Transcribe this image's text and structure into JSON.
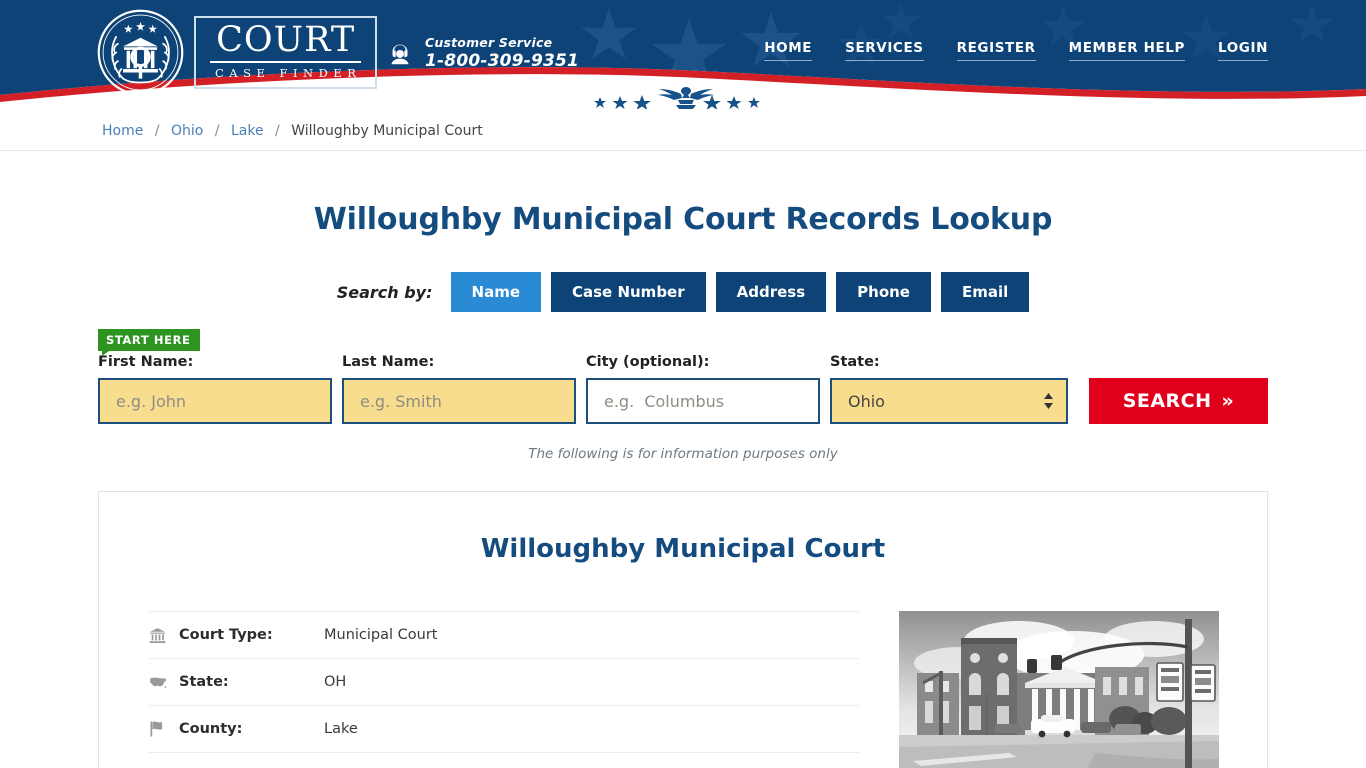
{
  "header": {
    "logo": {
      "icon": "court-seal-icon",
      "main": "COURT",
      "sub": "CASE FINDER"
    },
    "customer_service": {
      "icon": "headset-icon",
      "label": "Customer Service",
      "phone": "1-800-309-9351"
    },
    "nav": [
      {
        "label": "HOME"
      },
      {
        "label": "SERVICES"
      },
      {
        "label": "REGISTER"
      },
      {
        "label": "MEMBER HELP"
      },
      {
        "label": "LOGIN"
      }
    ],
    "colors": {
      "navy": "#0d4377",
      "red": "#d32027",
      "white": "#ffffff"
    }
  },
  "breadcrumb": {
    "items": [
      {
        "label": "Home",
        "link": true
      },
      {
        "label": "Ohio",
        "link": true
      },
      {
        "label": "Lake",
        "link": true
      },
      {
        "label": "Willoughby Municipal Court",
        "link": false
      }
    ],
    "separator": "/"
  },
  "main": {
    "page_title": "Willoughby Municipal Court Records Lookup",
    "search_by_label": "Search by:",
    "tabs": [
      {
        "label": "Name",
        "active": true
      },
      {
        "label": "Case Number",
        "active": false
      },
      {
        "label": "Address",
        "active": false
      },
      {
        "label": "Phone",
        "active": false
      },
      {
        "label": "Email",
        "active": false
      }
    ],
    "start_here_badge": "START HERE",
    "form": {
      "first_name": {
        "label": "First Name:",
        "placeholder": "e.g. John",
        "value": ""
      },
      "last_name": {
        "label": "Last Name:",
        "placeholder": "e.g. Smith",
        "value": ""
      },
      "city": {
        "label": "City (optional):",
        "placeholder": "e.g.  Columbus",
        "value": ""
      },
      "state": {
        "label": "State:",
        "selected": "Ohio"
      },
      "search_button": "SEARCH",
      "search_button_chevron": "»"
    },
    "disclaimer": "The following is for information purposes only"
  },
  "card": {
    "title": "Willoughby Municipal Court",
    "rows": [
      {
        "icon": "bank-icon",
        "key": "Court Type:",
        "value": "Municipal Court"
      },
      {
        "icon": "us-map-icon",
        "key": "State:",
        "value": "OH"
      },
      {
        "icon": "flag-icon",
        "key": "County:",
        "value": "Lake"
      }
    ],
    "photo": {
      "name": "courthouse-photo",
      "alt": "Willoughby Municipal Court building"
    }
  }
}
